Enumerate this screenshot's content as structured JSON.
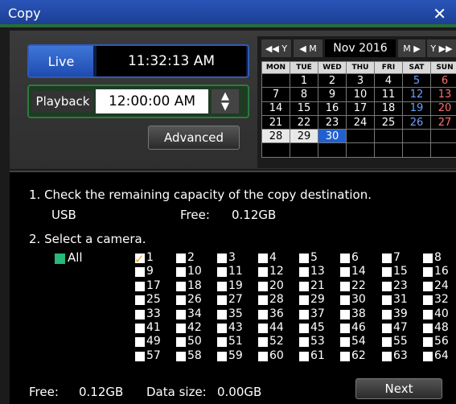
{
  "window": {
    "title": "Copy",
    "close": "✕"
  },
  "live": {
    "label": "Live",
    "time": "11:32:13 AM"
  },
  "playback": {
    "label": "Playback",
    "time": "12:00:00 AM",
    "up": "▲",
    "down": "▼"
  },
  "advanced_label": "Advanced",
  "calendar": {
    "nav": {
      "prev_year": "◀◀ Y",
      "prev_month": "◀ M",
      "next_month": "M ▶",
      "next_year": "Y ▶▶"
    },
    "month_label": "Nov 2016",
    "weekdays": [
      "MON",
      "TUE",
      "WED",
      "THU",
      "FRI",
      "SAT",
      "SUN"
    ],
    "weeks": [
      [
        "",
        "1",
        "2",
        "3",
        "4",
        "5",
        "6"
      ],
      [
        "7",
        "8",
        "9",
        "10",
        "11",
        "12",
        "13"
      ],
      [
        "14",
        "15",
        "16",
        "17",
        "18",
        "19",
        "20"
      ],
      [
        "21",
        "22",
        "23",
        "24",
        "25",
        "26",
        "27"
      ],
      [
        "28",
        "29",
        "30",
        "",
        "",
        "",
        ""
      ],
      [
        "",
        "",
        "",
        "",
        "",
        "",
        ""
      ]
    ],
    "selected_day": "30",
    "highlighted_days": [
      "28",
      "29"
    ]
  },
  "step1": {
    "text": "1. Check the remaining capacity of the copy destination.",
    "device": "USB",
    "free_label": "Free:",
    "free_value": "0.12GB"
  },
  "step2": {
    "text": "2. Select a camera.",
    "all_label": "All",
    "cameras": [
      "1",
      "2",
      "3",
      "4",
      "5",
      "6",
      "7",
      "8",
      "9",
      "10",
      "11",
      "12",
      "13",
      "14",
      "15",
      "16",
      "17",
      "18",
      "19",
      "20",
      "21",
      "22",
      "23",
      "24",
      "25",
      "26",
      "27",
      "28",
      "29",
      "30",
      "31",
      "32",
      "33",
      "34",
      "35",
      "36",
      "37",
      "38",
      "39",
      "40",
      "41",
      "42",
      "43",
      "44",
      "45",
      "46",
      "47",
      "48",
      "49",
      "50",
      "51",
      "52",
      "53",
      "54",
      "55",
      "56",
      "57",
      "58",
      "59",
      "60",
      "61",
      "62",
      "63",
      "64"
    ],
    "checked": [
      "1"
    ]
  },
  "footer": {
    "free_label": "Free:",
    "free_value": "0.12GB",
    "data_size_label": "Data size:",
    "data_size_value": "0.00GB",
    "next_label": "Next"
  }
}
